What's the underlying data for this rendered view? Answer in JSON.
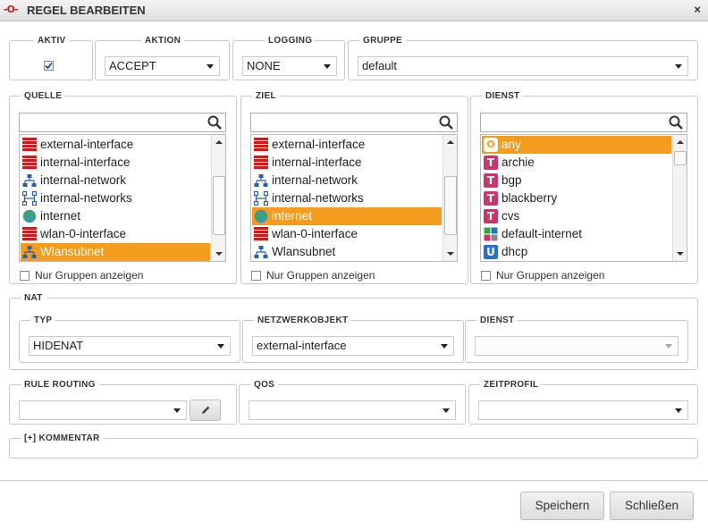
{
  "dialog": {
    "title": "REGEL BEARBEITEN",
    "close": "×",
    "logo": "-O-"
  },
  "aktiv": {
    "legend": "AKTIV",
    "checked": true
  },
  "aktion": {
    "legend": "AKTION",
    "value": "ACCEPT"
  },
  "logging": {
    "legend": "LOGGING",
    "value": "NONE"
  },
  "gruppe": {
    "legend": "GRUPPE",
    "value": "default"
  },
  "quelle": {
    "legend": "QUELLE",
    "search_value": "",
    "items": [
      {
        "label": "external-interface",
        "icon": "firewall-icon"
      },
      {
        "label": "internal-interface",
        "icon": "firewall-icon"
      },
      {
        "label": "internal-network",
        "icon": "network-icon"
      },
      {
        "label": "internal-networks",
        "icon": "networks-icon"
      },
      {
        "label": "internet",
        "icon": "globe-icon"
      },
      {
        "label": "wlan-0-interface",
        "icon": "firewall-icon"
      },
      {
        "label": "Wlansubnet",
        "icon": "network-icon"
      }
    ],
    "selected": "Wlansubnet",
    "groups_only_label": "Nur Gruppen anzeigen"
  },
  "ziel": {
    "legend": "ZIEL",
    "search_value": "",
    "items": [
      {
        "label": "external-interface",
        "icon": "firewall-icon"
      },
      {
        "label": "internal-interface",
        "icon": "firewall-icon"
      },
      {
        "label": "internal-network",
        "icon": "network-icon"
      },
      {
        "label": "internal-networks",
        "icon": "networks-icon"
      },
      {
        "label": "internet",
        "icon": "globe-icon"
      },
      {
        "label": "wlan-0-interface",
        "icon": "firewall-icon"
      },
      {
        "label": "Wlansubnet",
        "icon": "network-icon"
      }
    ],
    "selected": "internet",
    "groups_only_label": "Nur Gruppen anzeigen"
  },
  "dienst": {
    "legend": "DIENST",
    "search_value": "",
    "items": [
      {
        "label": "any",
        "icon": "any-service-icon",
        "glyph": "O"
      },
      {
        "label": "archie",
        "icon": "tcp-icon",
        "glyph": "T"
      },
      {
        "label": "bgp",
        "icon": "tcp-icon",
        "glyph": "T"
      },
      {
        "label": "blackberry",
        "icon": "tcp-icon",
        "glyph": "T"
      },
      {
        "label": "cvs",
        "icon": "tcp-icon",
        "glyph": "T"
      },
      {
        "label": "default-internet",
        "icon": "service-group-icon",
        "glyph": ""
      },
      {
        "label": "dhcp",
        "icon": "udp-icon",
        "glyph": "U"
      }
    ],
    "selected": "any",
    "groups_only_label": "Nur Gruppen anzeigen"
  },
  "nat": {
    "legend": "NAT",
    "typ": {
      "legend": "TYP",
      "value": "HIDENAT"
    },
    "netzwerkobjekt": {
      "legend": "NETZWERKOBJEKT",
      "value": "external-interface"
    },
    "dienst": {
      "legend": "DIENST",
      "value": ""
    }
  },
  "rule_routing": {
    "legend": "RULE ROUTING",
    "value": ""
  },
  "qos": {
    "legend": "QOS",
    "value": ""
  },
  "zeitprofil": {
    "legend": "ZEITPROFIL",
    "value": ""
  },
  "kommentar": {
    "legend": "[+] KOMMENTAR"
  },
  "buttons": {
    "save": "Speichern",
    "close": "Schließen"
  },
  "colors": {
    "selection": "#f39c1e",
    "firewall": "#c0211b",
    "tcp": "#c4386a",
    "udp": "#2a6fc9"
  }
}
